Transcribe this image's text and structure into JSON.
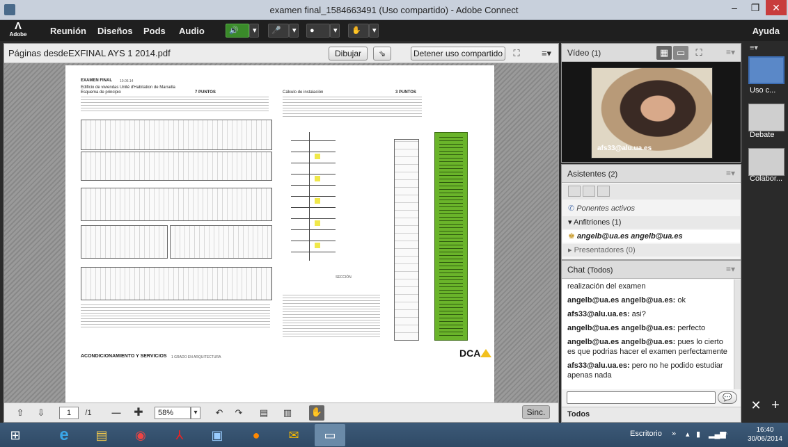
{
  "window": {
    "title": "examen final_1584663491 (Uso compartido) - Adobe Connect"
  },
  "menubar": {
    "logo": "Adobe",
    "items": [
      "Reunión",
      "Diseños",
      "Pods",
      "Audio"
    ],
    "help": "Ayuda"
  },
  "share": {
    "title": "Páginas desdeEXFINAL AYS 1 2014.pdf",
    "draw_label": "Dibujar",
    "stop_label": "Detener uso compartido",
    "page_current": "1",
    "page_total": "/1",
    "zoom": "58%",
    "sync_label": "Sinc."
  },
  "document": {
    "exam_title": "EXAMEN FINAL",
    "date": "10.06.14",
    "building": "Edificio de viviendas Unité d'Habitation de Marsella",
    "section1": "Esquema de principio",
    "points1": "7 PUNTOS",
    "section2": "Cálculo de instalación",
    "points2": "3 PUNTOS",
    "section_label": "SECCIÓN",
    "footer": "ACONDICIONAMIENTO Y SERVICIOS",
    "footer_sub": "1 GRADO EN ARQUITECTURA",
    "brand": "DCA"
  },
  "video": {
    "title": "Vídeo",
    "count": "(1)",
    "participant": "afs33@alu.ua.es"
  },
  "asistentes": {
    "title": "Asistentes",
    "count": "(2)",
    "active_speakers": "Ponentes activos",
    "hosts": "Anfitriones (1)",
    "host_user": "angelb@ua.es angelb@ua.es",
    "presenters": "Presentadores (0)"
  },
  "chat": {
    "title": "Chat",
    "scope": "(Todos)",
    "recipient": "Todos",
    "messages": [
      {
        "who": "",
        "text": "realización del examen"
      },
      {
        "who": "angelb@ua.es angelb@ua.es:",
        "text": " ok"
      },
      {
        "who": "afs33@alu.ua.es:",
        "text": " asi?"
      },
      {
        "who": "angelb@ua.es angelb@ua.es:",
        "text": " perfecto"
      },
      {
        "who": "angelb@ua.es angelb@ua.es:",
        "text": " pues lo cierto es que podrias hacer el examen perfectamente"
      },
      {
        "who": "afs33@alu.ua.es:",
        "text": " pero no he podido estudiar apenas nada"
      }
    ]
  },
  "layouts": [
    {
      "label": "Uso c..."
    },
    {
      "label": "Debate"
    },
    {
      "label": "Colabor..."
    }
  ],
  "taskbar": {
    "desktop": "Escritorio",
    "time": "16:40",
    "date": "30/06/2014"
  }
}
